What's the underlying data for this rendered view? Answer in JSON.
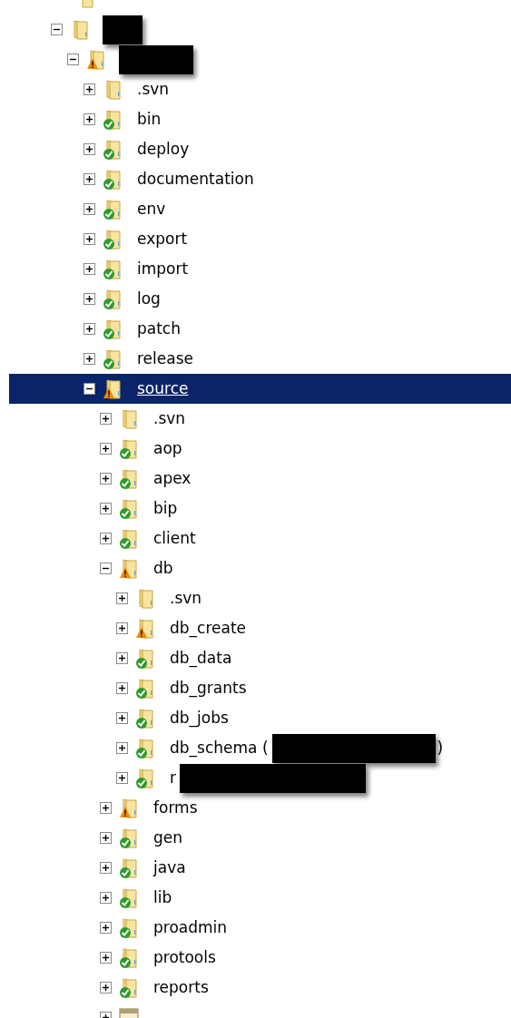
{
  "tree": [
    {
      "kind": "folder",
      "versioned": false,
      "modified": false,
      "expanded": true,
      "selected": false,
      "redacted": true,
      "children": [
        {
          "kind": "folder",
          "versioned": true,
          "modified": true,
          "expanded": true,
          "selected": false,
          "redacted": true,
          "children": [
            {
              "kind": "folder",
              "label": ".svn",
              "versioned": false,
              "modified": false,
              "expanded": false,
              "selected": false
            },
            {
              "kind": "folder",
              "label": "bin",
              "versioned": true,
              "modified": false,
              "expanded": false,
              "selected": false
            },
            {
              "kind": "folder",
              "label": "deploy",
              "versioned": true,
              "modified": false,
              "expanded": false,
              "selected": false
            },
            {
              "kind": "folder",
              "label": "documentation",
              "versioned": true,
              "modified": false,
              "expanded": false,
              "selected": false
            },
            {
              "kind": "folder",
              "label": "env",
              "versioned": true,
              "modified": false,
              "expanded": false,
              "selected": false
            },
            {
              "kind": "folder",
              "label": "export",
              "versioned": true,
              "modified": false,
              "expanded": false,
              "selected": false
            },
            {
              "kind": "folder",
              "label": "import",
              "versioned": true,
              "modified": false,
              "expanded": false,
              "selected": false
            },
            {
              "kind": "folder",
              "label": "log",
              "versioned": true,
              "modified": false,
              "expanded": false,
              "selected": false
            },
            {
              "kind": "folder",
              "label": "patch",
              "versioned": true,
              "modified": false,
              "expanded": false,
              "selected": false
            },
            {
              "kind": "folder",
              "label": "release",
              "versioned": true,
              "modified": false,
              "expanded": false,
              "selected": false
            },
            {
              "kind": "folder",
              "label": "source",
              "versioned": true,
              "modified": true,
              "expanded": true,
              "selected": true,
              "children": [
                {
                  "kind": "folder",
                  "label": ".svn",
                  "versioned": false,
                  "modified": false,
                  "expanded": false,
                  "selected": false
                },
                {
                  "kind": "folder",
                  "label": "aop",
                  "versioned": true,
                  "modified": false,
                  "expanded": false,
                  "selected": false
                },
                {
                  "kind": "folder",
                  "label": "apex",
                  "versioned": true,
                  "modified": false,
                  "expanded": false,
                  "selected": false
                },
                {
                  "kind": "folder",
                  "label": "bip",
                  "versioned": true,
                  "modified": false,
                  "expanded": false,
                  "selected": false
                },
                {
                  "kind": "folder",
                  "label": "client",
                  "versioned": true,
                  "modified": false,
                  "expanded": false,
                  "selected": false
                },
                {
                  "kind": "folder",
                  "label": "db",
                  "versioned": true,
                  "modified": true,
                  "expanded": true,
                  "selected": false,
                  "children": [
                    {
                      "kind": "folder",
                      "label": ".svn",
                      "versioned": false,
                      "modified": false,
                      "expanded": false,
                      "selected": false
                    },
                    {
                      "kind": "folder",
                      "label": "db_create",
                      "versioned": true,
                      "modified": true,
                      "expanded": false,
                      "selected": false
                    },
                    {
                      "kind": "folder",
                      "label": "db_data",
                      "versioned": true,
                      "modified": false,
                      "expanded": false,
                      "selected": false
                    },
                    {
                      "kind": "folder",
                      "label": "db_grants",
                      "versioned": true,
                      "modified": false,
                      "expanded": false,
                      "selected": false
                    },
                    {
                      "kind": "folder",
                      "label": "db_jobs",
                      "versioned": true,
                      "modified": false,
                      "expanded": false,
                      "selected": false
                    },
                    {
                      "kind": "folder",
                      "label": "db_schema (",
                      "label_end": ")",
                      "versioned": true,
                      "modified": false,
                      "expanded": false,
                      "selected": false,
                      "redacted": true
                    },
                    {
                      "kind": "folder",
                      "label": "r",
                      "versioned": true,
                      "modified": false,
                      "expanded": false,
                      "selected": false,
                      "redacted": true
                    }
                  ]
                },
                {
                  "kind": "folder",
                  "label": "forms",
                  "versioned": true,
                  "modified": true,
                  "expanded": false,
                  "selected": false
                },
                {
                  "kind": "folder",
                  "label": "gen",
                  "versioned": true,
                  "modified": false,
                  "expanded": false,
                  "selected": false
                },
                {
                  "kind": "folder",
                  "label": "java",
                  "versioned": true,
                  "modified": false,
                  "expanded": false,
                  "selected": false
                },
                {
                  "kind": "folder",
                  "label": "lib",
                  "versioned": true,
                  "modified": false,
                  "expanded": false,
                  "selected": false
                },
                {
                  "kind": "folder",
                  "label": "proadmin",
                  "versioned": true,
                  "modified": false,
                  "expanded": false,
                  "selected": false
                },
                {
                  "kind": "folder",
                  "label": "protools",
                  "versioned": true,
                  "modified": false,
                  "expanded": false,
                  "selected": false
                },
                {
                  "kind": "folder",
                  "label": "reports",
                  "versioned": true,
                  "modified": false,
                  "expanded": false,
                  "selected": false
                },
                {
                  "kind": "zip",
                  "expanded": false,
                  "selected": false
                }
              ]
            }
          ]
        }
      ]
    }
  ]
}
